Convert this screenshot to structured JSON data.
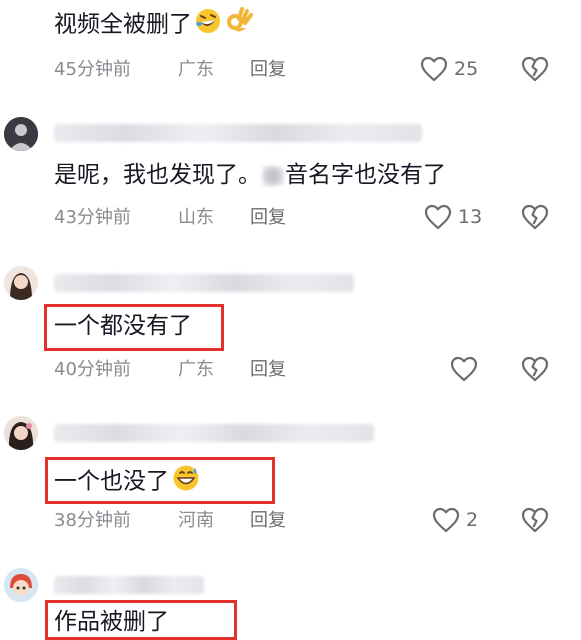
{
  "comments": [
    {
      "text": "视频全被删了",
      "emoji_names": [
        "rolling-laughing-emoji",
        "ok-hand-emoji"
      ],
      "time": "45分钟前",
      "location": "广东",
      "reply_label": "回复",
      "like_count": "25"
    },
    {
      "text_part1": "是呢，我也发现了。",
      "text_part2": "音名字也没有了",
      "time": "43分钟前",
      "location": "山东",
      "reply_label": "回复",
      "like_count": "13"
    },
    {
      "text": "一个都没有了",
      "time": "40分钟前",
      "location": "广东",
      "reply_label": "回复",
      "like_count": ""
    },
    {
      "text": "一个也没了",
      "emoji_names": [
        "grinning-sweat-emoji"
      ],
      "time": "38分钟前",
      "location": "河南",
      "reply_label": "回复",
      "like_count": "2"
    },
    {
      "text": "作品被删了"
    }
  ],
  "colors": {
    "highlight": "#e2322b",
    "text": "#161823",
    "meta": "#8a8b91"
  },
  "icons": [
    "heart-outline-icon",
    "broken-heart-icon"
  ]
}
